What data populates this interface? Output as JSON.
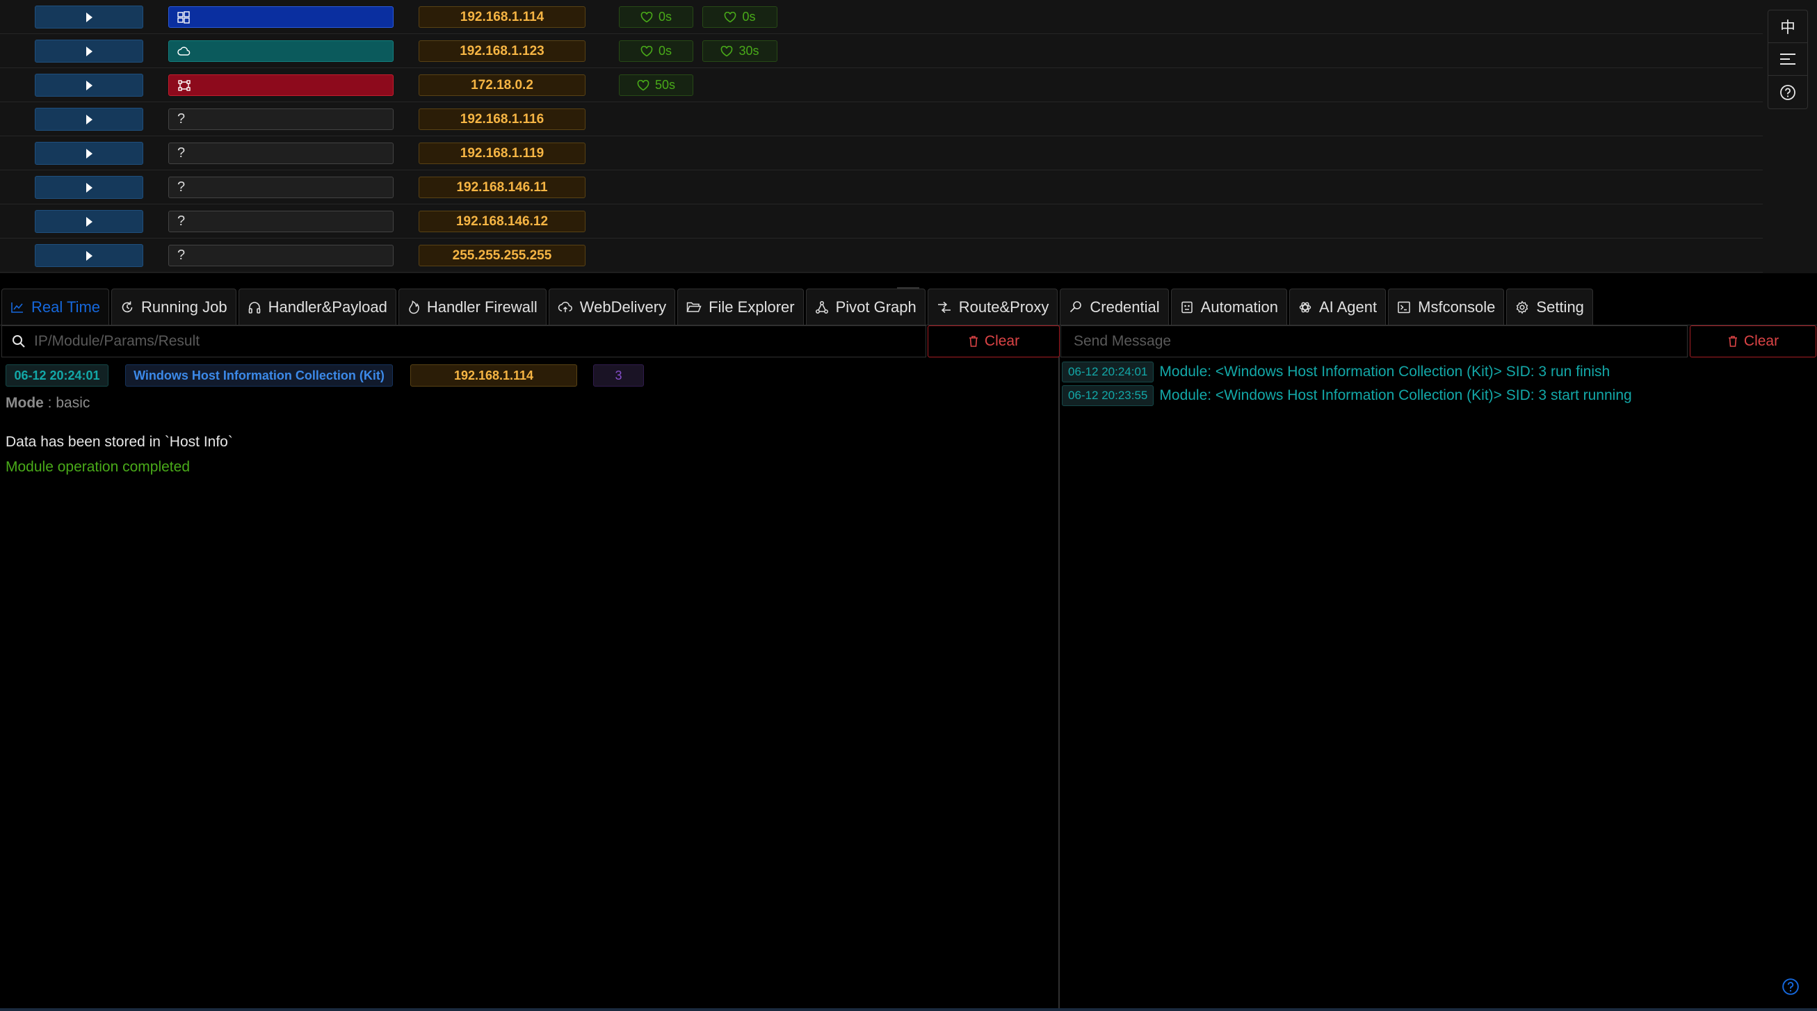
{
  "hosts": [
    {
      "os": "windows",
      "os_icon": "windows-icon",
      "ip": "192.168.1.114",
      "hb1": "0s",
      "hb2": "0s"
    },
    {
      "os": "linux",
      "os_icon": "cloud-icon",
      "ip": "192.168.1.123",
      "hb1": "0s",
      "hb2": "30s"
    },
    {
      "os": "router",
      "os_icon": "router-icon",
      "ip": "172.18.0.2",
      "hb1": "50s"
    },
    {
      "os": "unknown",
      "os_label": "?",
      "ip": "192.168.1.116"
    },
    {
      "os": "unknown",
      "os_label": "?",
      "ip": "192.168.1.119"
    },
    {
      "os": "unknown",
      "os_label": "?",
      "ip": "192.168.146.11"
    },
    {
      "os": "unknown",
      "os_label": "?",
      "ip": "192.168.146.12"
    },
    {
      "os": "unknown",
      "os_label": "?",
      "ip": "255.255.255.255"
    }
  ],
  "float_buttons": {
    "lang": "中",
    "menu_icon": "list-icon",
    "help_icon": "question-icon"
  },
  "tabs": [
    {
      "label": "Real Time",
      "icon": "line-chart-icon",
      "active": true
    },
    {
      "label": "Running Job",
      "icon": "sync-icon"
    },
    {
      "label": "Handler&Payload",
      "icon": "headphones-icon"
    },
    {
      "label": "Handler Firewall",
      "icon": "fire-icon"
    },
    {
      "label": "WebDelivery",
      "icon": "cloud-upload-icon"
    },
    {
      "label": "File Explorer",
      "icon": "folder-open-icon"
    },
    {
      "label": "Pivot Graph",
      "icon": "graph-icon"
    },
    {
      "label": "Route&Proxy",
      "icon": "route-icon"
    },
    {
      "label": "Credential",
      "icon": "key-icon"
    },
    {
      "label": "Automation",
      "icon": "robot-icon"
    },
    {
      "label": "AI Agent",
      "icon": "openai-icon"
    },
    {
      "label": "Msfconsole",
      "icon": "terminal-icon"
    },
    {
      "label": "Setting",
      "icon": "gear-icon"
    }
  ],
  "left": {
    "search_placeholder": "IP/Module/Params/Result",
    "clear_label": "Clear",
    "result": {
      "time": "06-12 20:24:01",
      "module": "Windows Host Information Collection (Kit)",
      "ip": "192.168.1.114",
      "sid": "3",
      "mode_key": "Mode",
      "mode_sep": " : ",
      "mode_value": "basic",
      "stored": "Data has been stored in `Host Info`",
      "completed": "Module operation completed"
    }
  },
  "right": {
    "message_placeholder": "Send Message",
    "clear_label": "Clear",
    "messages": [
      {
        "time": "06-12 20:24:01",
        "text": "Module: <Windows Host Information Collection (Kit)> SID: 3 run finish"
      },
      {
        "time": "06-12 20:23:55",
        "text": "Module: <Windows Host Information Collection (Kit)> SID: 3 start running"
      }
    ]
  },
  "colors": {
    "accent": "#1668dc",
    "ip_text": "#f6b544",
    "heartbeat": "#49aa19",
    "danger": "#dc4446",
    "cyan": "#13a8a8"
  }
}
